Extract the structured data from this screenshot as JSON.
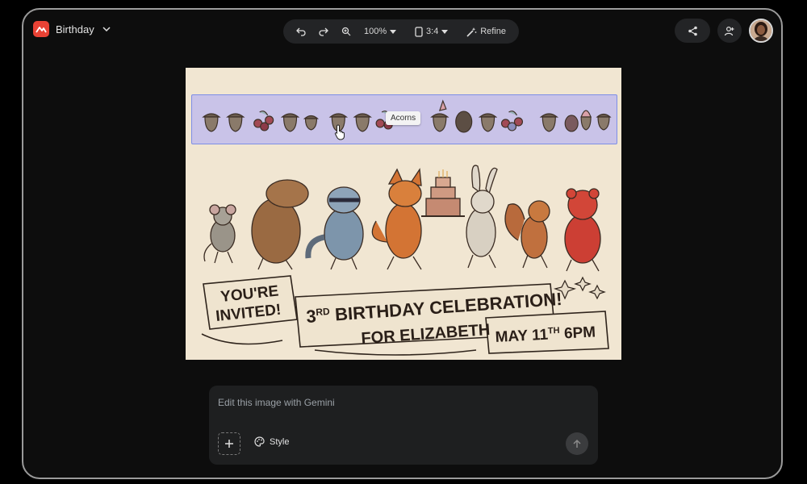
{
  "header": {
    "title": "Birthday",
    "icons": {
      "logo": "canvas-logo-icon",
      "dropdown": "chevron-down-icon"
    }
  },
  "toolbar": {
    "zoom_label": "100%",
    "aspect_label": "3:4",
    "refine_label": "Refine"
  },
  "canvas": {
    "tooltip": "Acorns",
    "banner": {
      "left_text_1": "YOU'RE",
      "left_text_2": "INVITED!",
      "center_text_1a": "3",
      "center_text_1b": "RD",
      "center_text_1c": " BIRTHDAY CELEBRATION!",
      "center_text_2": "FOR ELIZABETH",
      "right_text_a": "MAY 11",
      "right_text_b": "TH",
      "right_text_c": " 6PM"
    }
  },
  "composer": {
    "placeholder": "Edit this image with Gemini",
    "style_label": "Style"
  },
  "colors": {
    "accent_logo": "#e94235",
    "panel_bg": "#232426",
    "page_bg": "#0d0d0d"
  }
}
